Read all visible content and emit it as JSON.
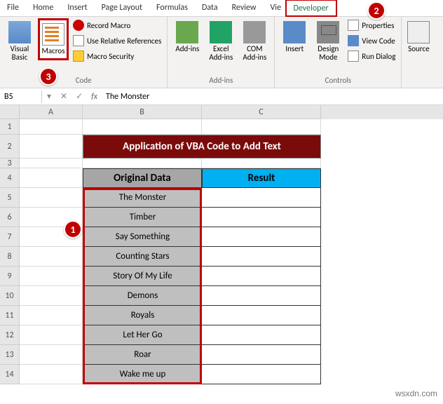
{
  "menubar": {
    "tabs": [
      "File",
      "Home",
      "Insert",
      "Page Layout",
      "Formulas",
      "Data",
      "Review",
      "View",
      "Developer"
    ]
  },
  "ribbon": {
    "code": {
      "label": "Code",
      "visual_basic": "Visual Basic",
      "macros": "Macros",
      "record_macro": "Record Macro",
      "use_relative": "Use Relative References",
      "macro_security": "Macro Security"
    },
    "addins": {
      "label": "Add-ins",
      "addins": "Add-ins",
      "excel_addins": "Excel Add-ins",
      "com_addins": "COM Add-ins"
    },
    "controls": {
      "label": "Controls",
      "insert": "Insert",
      "design_mode": "Design Mode",
      "properties": "Properties",
      "view_code": "View Code",
      "run_dialog": "Run Dialog"
    },
    "xml_source": "Source"
  },
  "namebox": {
    "cell": "B5",
    "fx": "fx",
    "formula": "The Monster"
  },
  "columns": [
    "A",
    "B",
    "C"
  ],
  "rows": [
    "1",
    "2",
    "3",
    "4",
    "5",
    "6",
    "7",
    "8",
    "9",
    "10",
    "11",
    "12",
    "13",
    "14"
  ],
  "title": "Application of VBA Code to Add Text",
  "headers": {
    "b": "Original Data",
    "c": "Result"
  },
  "data": [
    "The Monster",
    "Timber",
    "Say Something",
    "Counting Stars",
    "Story Of My Life",
    "Demons",
    "Royals",
    "Let Her Go",
    "Roar",
    "Wake me up"
  ],
  "badges": {
    "b1": "1",
    "b2": "2",
    "b3": "3"
  },
  "watermark": "wsxdn.com"
}
